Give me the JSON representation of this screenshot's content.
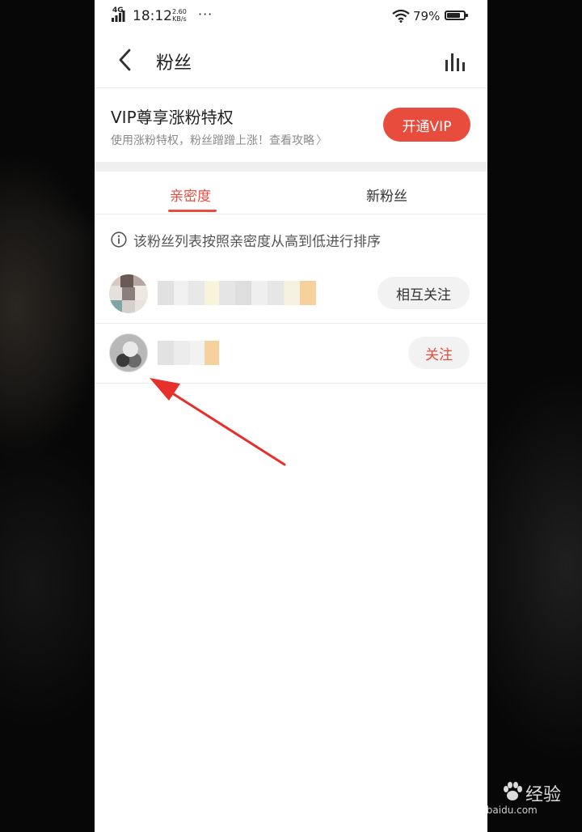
{
  "status_bar": {
    "network": "4G",
    "time": "18:12",
    "speed_value": "2.60",
    "speed_unit": "KB/s",
    "more": "···",
    "battery": "79%",
    "battery_level": 0.79
  },
  "header": {
    "title": "粉丝"
  },
  "vip_banner": {
    "title": "VIP尊享涨粉特权",
    "subtitle": "使用涨粉特权，粉丝蹭蹭上涨！查看攻略",
    "button": "开通VIP"
  },
  "tabs": [
    {
      "label": "亲密度",
      "active": true
    },
    {
      "label": "新粉丝",
      "active": false
    }
  ],
  "note": "该粉丝列表按照亲密度从高到低进行排序",
  "fans": [
    {
      "action": "相互关注"
    },
    {
      "action": "关注"
    }
  ],
  "colors": {
    "accent": "#e84c3d"
  },
  "watermark": {
    "logo": "Bai",
    "logo_cn": "经验",
    "url": "jingyan.baidu.com"
  }
}
